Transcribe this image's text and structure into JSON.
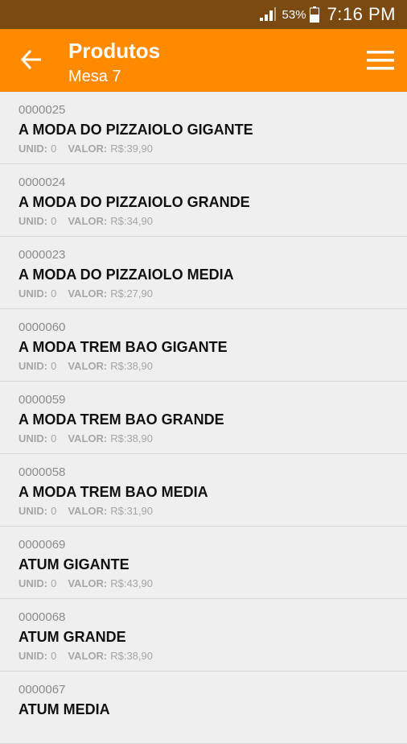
{
  "status_bar": {
    "battery_percent": "53%",
    "time": "7:16 PM"
  },
  "app_bar": {
    "title": "Produtos",
    "subtitle": "Mesa 7",
    "back_icon": "arrow-left-icon",
    "menu_icon": "hamburger-menu-icon"
  },
  "labels": {
    "unid": "UNID:",
    "valor": "VALOR:"
  },
  "products": [
    {
      "code": "0000025",
      "name": "A MODA DO PIZZAIOLO GIGANTE",
      "unid": "0",
      "valor": "R$:39,90"
    },
    {
      "code": "0000024",
      "name": "A MODA DO PIZZAIOLO GRANDE",
      "unid": "0",
      "valor": "R$:34,90"
    },
    {
      "code": "0000023",
      "name": "A MODA DO PIZZAIOLO MEDIA",
      "unid": "0",
      "valor": "R$:27,90"
    },
    {
      "code": "0000060",
      "name": "A MODA TREM BAO GIGANTE",
      "unid": "0",
      "valor": "R$:38,90"
    },
    {
      "code": "0000059",
      "name": "A MODA TREM BAO GRANDE",
      "unid": "0",
      "valor": "R$:38,90"
    },
    {
      "code": "0000058",
      "name": "A MODA TREM BAO MEDIA",
      "unid": "0",
      "valor": "R$:31,90"
    },
    {
      "code": "0000069",
      "name": "ATUM GIGANTE",
      "unid": "0",
      "valor": "R$:43,90"
    },
    {
      "code": "0000068",
      "name": "ATUM GRANDE",
      "unid": "0",
      "valor": "R$:38,90"
    },
    {
      "code": "0000067",
      "name": "ATUM MEDIA",
      "unid": "",
      "valor": ""
    }
  ],
  "colors": {
    "status_bar": "#7a4a12",
    "app_bar": "#ff8a00",
    "background": "#efefef"
  }
}
